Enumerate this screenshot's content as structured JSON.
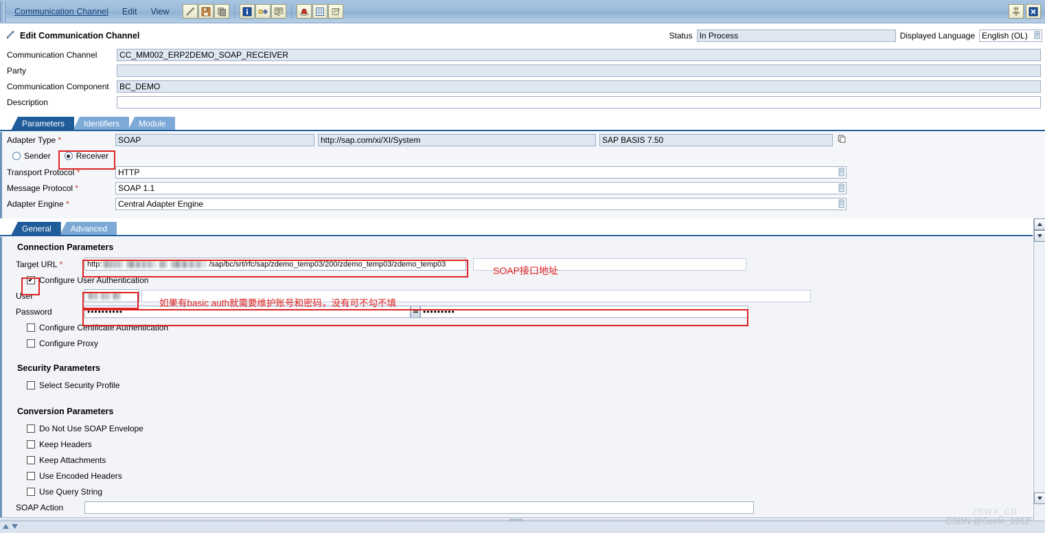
{
  "menu": {
    "items": [
      {
        "label": "Communication Channel",
        "link": true
      },
      {
        "label": "Edit",
        "link": false
      },
      {
        "label": "View",
        "link": false
      }
    ],
    "toolbar_group1": [
      {
        "name": "edit-pencil-icon",
        "title": "Edit"
      },
      {
        "name": "save-icon",
        "title": "Save"
      },
      {
        "name": "copy-icon",
        "title": "Copy"
      }
    ],
    "toolbar_group2": [
      {
        "name": "info-icon",
        "title": "Information"
      },
      {
        "name": "where-used-icon",
        "title": "Where Used"
      },
      {
        "name": "compare-icon",
        "title": "Compare"
      }
    ],
    "toolbar_group3": [
      {
        "name": "red-hat-icon",
        "title": "Cache Notification"
      },
      {
        "name": "table-icon",
        "title": "Table View"
      },
      {
        "name": "scroll-icon",
        "title": "Log"
      }
    ],
    "window_buttons": [
      {
        "name": "pin-icon",
        "title": "Pin"
      },
      {
        "name": "close-icon",
        "title": "Close"
      }
    ]
  },
  "header": {
    "title": "Edit Communication Channel",
    "title_icon": "channel-pen-icon",
    "status_label": "Status",
    "status_value": "In Process",
    "language_label": "Displayed Language",
    "language_value": "English (OL)",
    "fields": [
      {
        "label": "Communication Channel",
        "value": "CC_MM002_ERP2DEMO_SOAP_RECEIVER",
        "readonly": true,
        "name": "communication-channel-field"
      },
      {
        "label": "Party",
        "value": "",
        "readonly": true,
        "name": "party-field"
      },
      {
        "label": "Communication Component",
        "value": "BC_DEMO",
        "readonly": true,
        "name": "communication-component-field"
      },
      {
        "label": "Description",
        "value": "",
        "readonly": false,
        "name": "description-field"
      }
    ]
  },
  "tabs": [
    {
      "label": "Parameters",
      "active": true,
      "name": "tab-parameters"
    },
    {
      "label": "Identifiers",
      "active": false,
      "name": "tab-identifiers"
    },
    {
      "label": "Module",
      "active": false,
      "name": "tab-module"
    }
  ],
  "adapter": {
    "type_label": "Adapter Type",
    "type_value": "SOAP",
    "namespace_value": "http://sap.com/xi/XI/System",
    "swcv_value": "SAP BASIS 7.50",
    "direction": {
      "sender_label": "Sender",
      "receiver_label": "Receiver",
      "selected": "Receiver"
    },
    "rows": [
      {
        "label": "Transport Protocol",
        "value": "HTTP",
        "name": "transport-protocol-field"
      },
      {
        "label": "Message Protocol",
        "value": "SOAP 1.1",
        "name": "message-protocol-field"
      },
      {
        "label": "Adapter Engine",
        "value": "Central Adapter Engine",
        "name": "adapter-engine-field"
      }
    ]
  },
  "subtabs": [
    {
      "label": "General",
      "active": true,
      "name": "subtab-general"
    },
    {
      "label": "Advanced",
      "active": false,
      "name": "subtab-advanced"
    }
  ],
  "connection": {
    "section_title": "Connection Parameters",
    "target_url_label": "Target URL",
    "target_url_prefix": "http:",
    "target_url_suffix": "/sap/bc/srt/rfc/sap/zdemo_temp03/200/zdemo_temp03/zdemo_temp03",
    "configure_user_auth_label": "Configure User Authentication",
    "configure_user_auth_checked": true,
    "user_label": "User",
    "password_label": "Password",
    "password_value": "••••••••••",
    "password_confirm_value": "•••••••••",
    "configure_cert_auth_label": "Configure Certificate Authentication",
    "configure_cert_auth_checked": false,
    "configure_proxy_label": "Configure Proxy",
    "configure_proxy_checked": false
  },
  "security": {
    "section_title": "Security Parameters",
    "select_security_profile_label": "Select Security Profile",
    "select_security_profile_checked": false
  },
  "conversion": {
    "section_title": "Conversion Parameters",
    "checkboxes": [
      {
        "label": "Do Not Use SOAP Envelope",
        "checked": false,
        "name": "do-not-use-soap-envelope-checkbox"
      },
      {
        "label": "Keep Headers",
        "checked": false,
        "name": "keep-headers-checkbox"
      },
      {
        "label": "Keep Attachments",
        "checked": false,
        "name": "keep-attachments-checkbox"
      },
      {
        "label": "Use Encoded Headers",
        "checked": false,
        "name": "use-encoded-headers-checkbox"
      },
      {
        "label": "Use Query String",
        "checked": false,
        "name": "use-query-string-checkbox"
      }
    ],
    "soap_action_label": "SOAP Action",
    "soap_action_value": ""
  },
  "annotations": {
    "soap_url_note": "SOAP接口地址",
    "basic_auth_note": "如果有basic auth就需要维护账号和密码，没有可不勾不填"
  },
  "watermark": {
    "text": "CSDN @Seele_1012",
    "ghost": "ZBWX_CD"
  }
}
